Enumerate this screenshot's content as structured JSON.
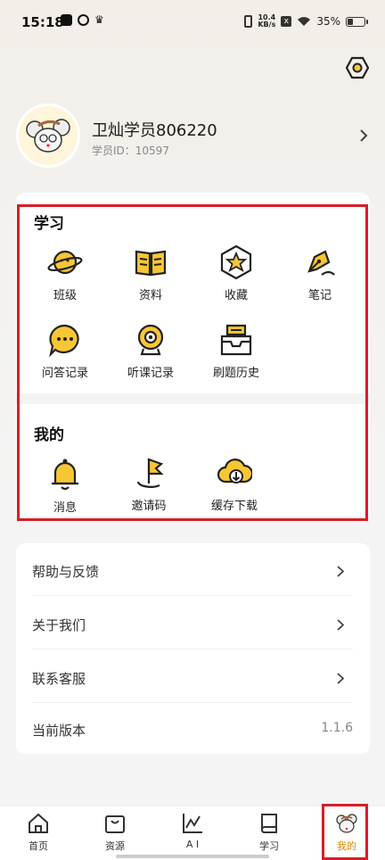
{
  "status_bar": {
    "time": "15:18",
    "net_speed_top": "10.4",
    "net_speed_bottom": "KB/s",
    "x_label": "x",
    "battery": "35%",
    "battery_level": 0.35
  },
  "profile": {
    "name": "卫灿学员806220",
    "id_label": "学员ID：",
    "id_value": "10597"
  },
  "study": {
    "title": "学习",
    "items": [
      {
        "label": "班级",
        "icon": "planet-icon"
      },
      {
        "label": "资料",
        "icon": "book-icon"
      },
      {
        "label": "收藏",
        "icon": "star-hexagon-icon"
      },
      {
        "label": "笔记",
        "icon": "pen-icon"
      },
      {
        "label": "问答记录",
        "icon": "chat-bubble-icon"
      },
      {
        "label": "听课记录",
        "icon": "webcam-icon"
      },
      {
        "label": "刷题历史",
        "icon": "inbox-icon"
      }
    ]
  },
  "mine": {
    "title": "我的",
    "items": [
      {
        "label": "消息",
        "icon": "bell-icon"
      },
      {
        "label": "邀请码",
        "icon": "flag-icon"
      },
      {
        "label": "缓存下载",
        "icon": "cloud-download-icon"
      }
    ]
  },
  "menu": {
    "help": "帮助与反馈",
    "about": "关于我们",
    "contact": "联系客服",
    "version_label": "当前版本",
    "version_value": "1.1.6"
  },
  "tabs": [
    {
      "label": "首页",
      "icon": "home-icon"
    },
    {
      "label": "资源",
      "icon": "shopping-bag-icon"
    },
    {
      "label": "A I",
      "icon": "chart-icon"
    },
    {
      "label": "学习",
      "icon": "book-icon"
    },
    {
      "label": "我的",
      "icon": "mouse-avatar-icon",
      "active": true
    }
  ],
  "colors": {
    "accent": "#f7c633",
    "active_tab": "#e08a00",
    "highlight": "#d81e27"
  }
}
